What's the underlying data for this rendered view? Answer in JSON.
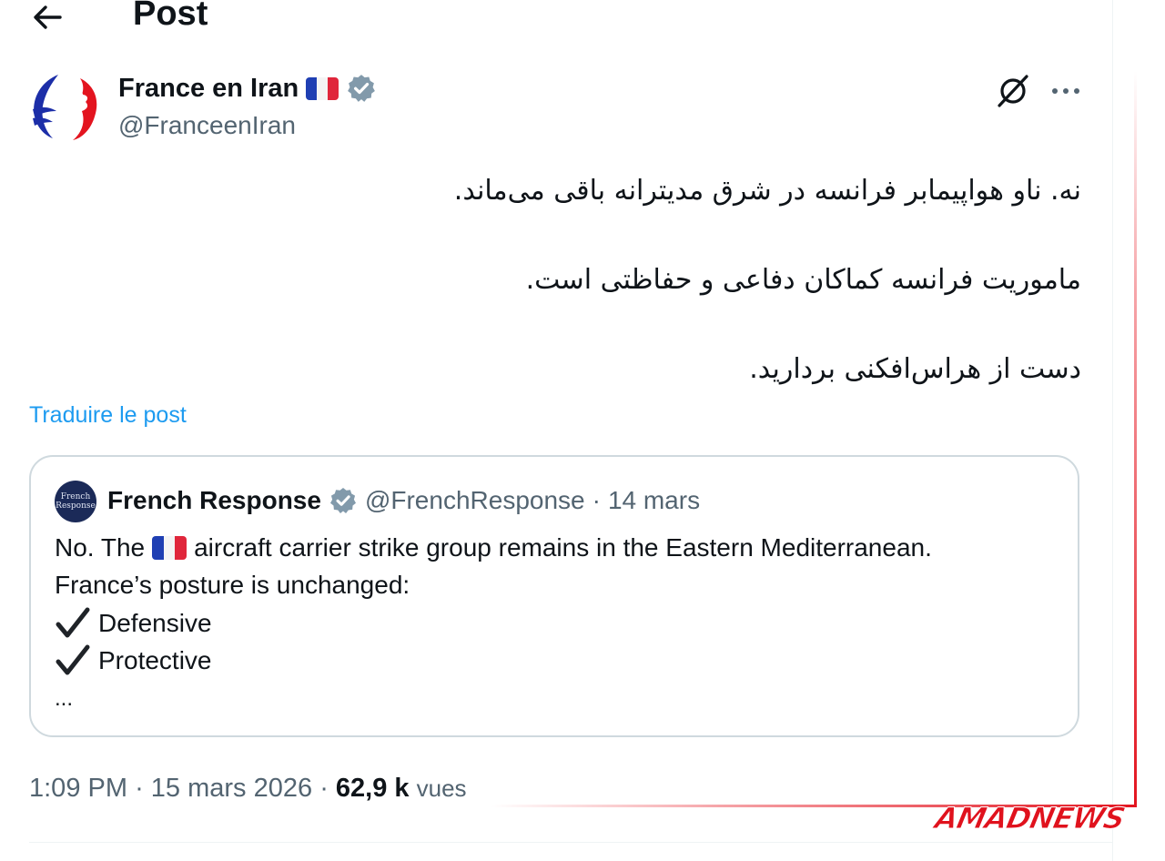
{
  "header": {
    "title": "Post",
    "back_icon": "arrow-left-icon"
  },
  "author": {
    "name": "France en Iran",
    "handle": "@FranceenIran",
    "verified_color": "#829aab",
    "flag_icon": "france-flag-icon"
  },
  "actions": {
    "grok_icon": "grok-icon",
    "more_icon": "more-dots-icon"
  },
  "post": {
    "lines": [
      "نه. ناو هواپیمابر فرانسه در شرق مدیترانه باقی می‌ماند.",
      "ماموریت فرانسه کماکان دفاعی و حفاظتی است.",
      "دست از هراس‌افکنی بردارید."
    ],
    "translate_link": "Traduire le post"
  },
  "quote": {
    "avatar_text": "French Response",
    "name": "French Response",
    "handle": "@FrenchResponse",
    "separator": "·",
    "date": "14 mars",
    "line1_prefix": "No. The",
    "line1_suffix": "aircraft carrier strike group remains in the Eastern Mediterranean.",
    "line2": "France’s posture is unchanged:",
    "item1": "Defensive",
    "item2": "Protective",
    "ellipsis": "..."
  },
  "meta": {
    "time": "1:09 PM",
    "sep1": "·",
    "date": "15 mars 2026",
    "sep2": "·",
    "views_count": "62,9 k",
    "views_label": "vues"
  },
  "watermark": {
    "text": "AMADNEWS",
    "color": "#e0121d"
  },
  "colors": {
    "link": "#1d9bf0",
    "secondary_text": "#536471",
    "primary_text": "#0f1419",
    "border": "#cfd9de"
  }
}
